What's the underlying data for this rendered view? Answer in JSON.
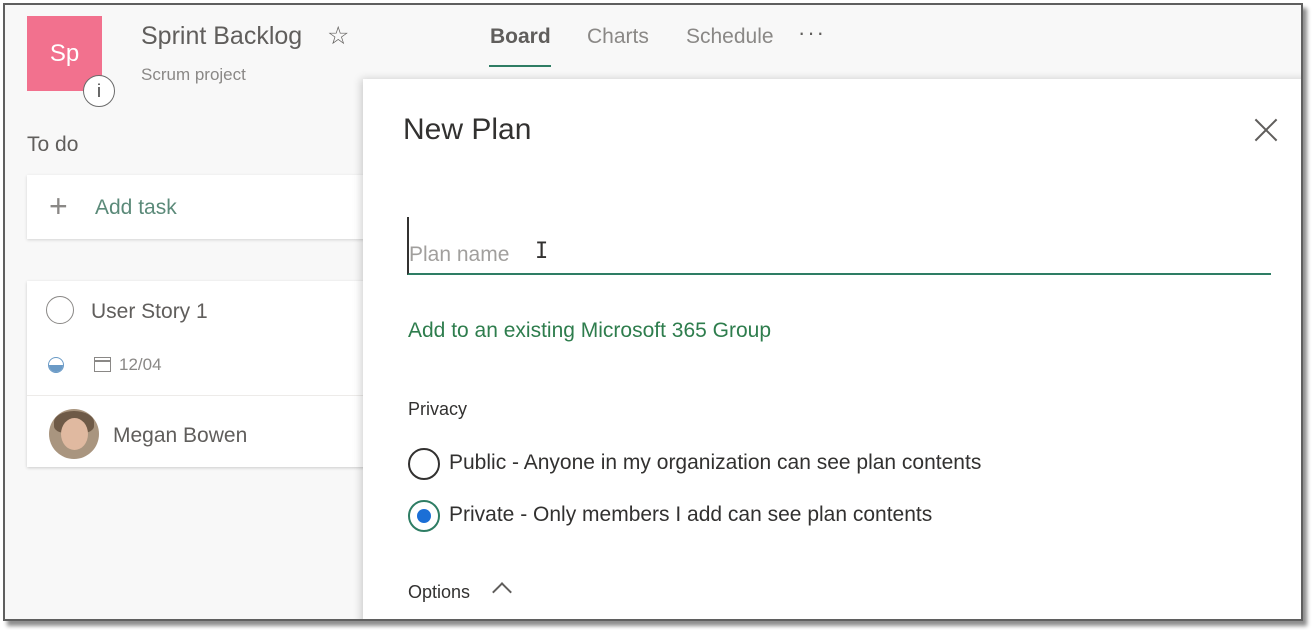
{
  "header": {
    "logo_text": "Sp",
    "info_icon_text": "i",
    "plan_title": "Sprint Backlog",
    "star_icon": "☆",
    "plan_subtitle": "Scrum project",
    "tabs": [
      {
        "label": "Board",
        "active": true
      },
      {
        "label": "Charts",
        "active": false
      },
      {
        "label": "Schedule",
        "active": false
      }
    ],
    "more_icon": "···"
  },
  "board": {
    "bucket_name": "To do",
    "add_task_icon": "+",
    "add_task_label": "Add task",
    "cards": [
      {
        "title": "User Story 1",
        "due_date": "12/04",
        "progress": 0.5,
        "assignee": "Megan Bowen"
      }
    ]
  },
  "panel": {
    "title": "New Plan",
    "plan_name_placeholder": "Plan name",
    "plan_name_value": "",
    "cursor_icon": "I",
    "group_link": "Add to an existing Microsoft 365 Group",
    "privacy_label": "Privacy",
    "privacy_options": [
      {
        "label": "Public - Anyone in my organization can see plan contents",
        "selected": false
      },
      {
        "label": "Private - Only members I add can see plan contents",
        "selected": true
      }
    ],
    "options_label": "Options"
  },
  "colors": {
    "logo_bg": "#f2718e",
    "accent_green": "#2e7d64",
    "link_green": "#2e7d4d",
    "radio_selected": "#1b6fd6"
  }
}
